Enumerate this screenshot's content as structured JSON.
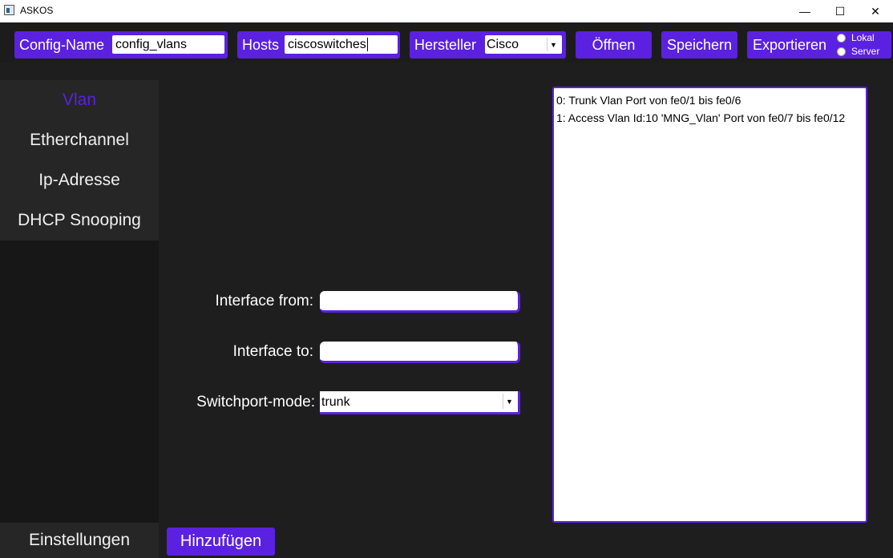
{
  "window": {
    "title": "ASKOS",
    "minimize": "—",
    "maximize": "☐",
    "close": "✕"
  },
  "toolbar": {
    "config_name_label": "Config-Name",
    "config_name_value": "config_vlans",
    "hosts_label": "Hosts",
    "hosts_value": "ciscoswitches",
    "hersteller_label": "Hersteller",
    "hersteller_value": "Cisco",
    "open_label": "Öffnen",
    "save_label": "Speichern",
    "export_label": "Exportieren",
    "radio_local": "Lokal",
    "radio_server": "Server"
  },
  "sidebar": {
    "items": [
      {
        "label": "Vlan"
      },
      {
        "label": "Etherchannel"
      },
      {
        "label": "Ip-Adresse"
      },
      {
        "label": "DHCP Snooping"
      }
    ],
    "settings_label": "Einstellungen"
  },
  "form": {
    "interface_from_label": "Interface from:",
    "interface_from_value": "",
    "interface_to_label": "Interface to:",
    "interface_to_value": "",
    "switchport_mode_label": "Switchport-mode:",
    "switchport_mode_value": "trunk",
    "add_label": "Hinzufügen"
  },
  "config_list": [
    "0: Trunk Vlan Port von fe0/1 bis fe0/6",
    "1: Access Vlan Id:10 'MNG_Vlan' Port von fe0/7 bis fe0/12"
  ],
  "colors": {
    "accent": "#5b21e0",
    "background": "#1e1e1e",
    "sidebar_item": "#262626"
  },
  "icons": [
    "app-icon",
    "minimize-icon",
    "maximize-icon",
    "close-icon",
    "dropdown-arrow-icon"
  ]
}
